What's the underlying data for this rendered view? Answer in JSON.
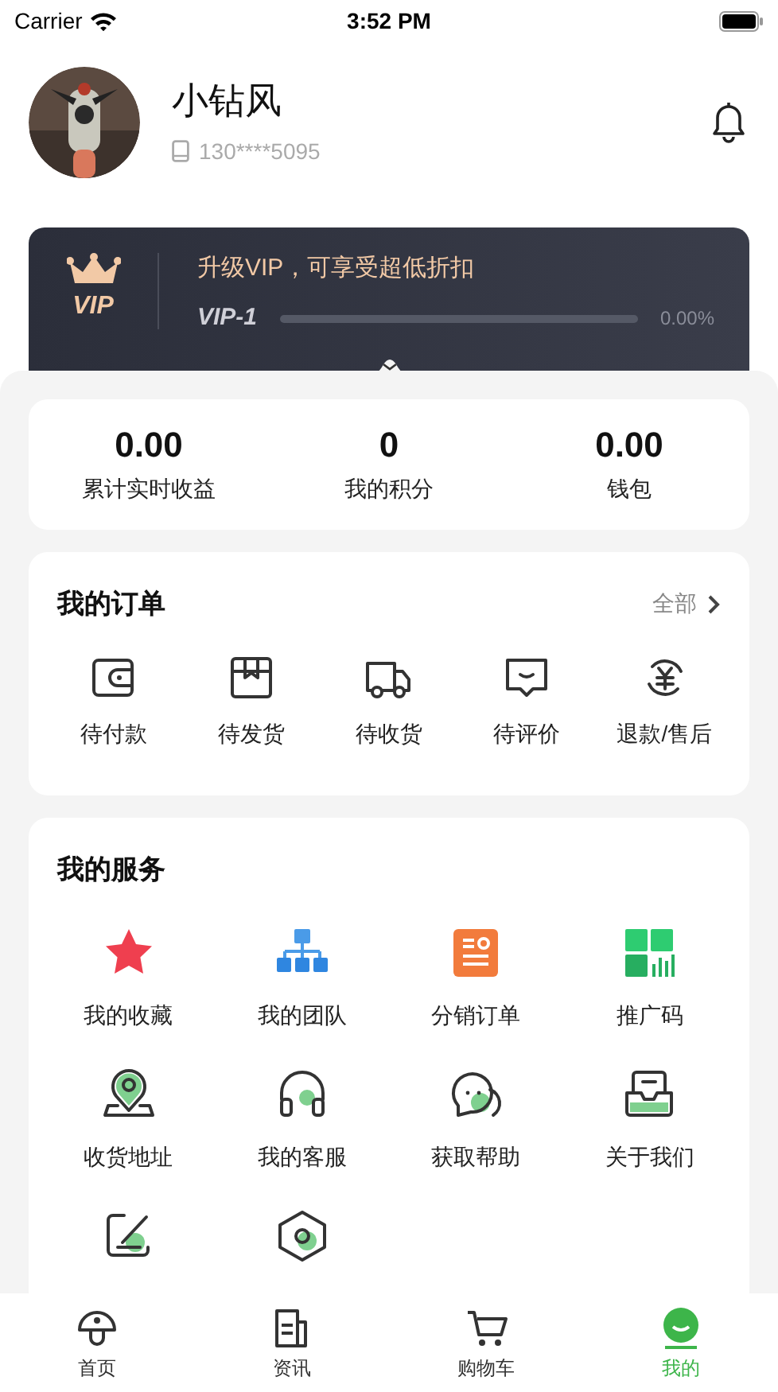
{
  "status_bar": {
    "carrier": "Carrier",
    "time": "3:52 PM"
  },
  "profile": {
    "name": "小钻风",
    "phone": "130****5095"
  },
  "vip": {
    "badge": "VIP",
    "promo": "升级VIP，可享受超低折扣",
    "level_label": "VIP-1",
    "level": 0,
    "percent": "0.00%"
  },
  "stats": [
    {
      "value": "0.00",
      "label": "累计实时收益"
    },
    {
      "value": "0",
      "label": "我的积分"
    },
    {
      "value": "0.00",
      "label": "钱包"
    }
  ],
  "orders": {
    "title": "我的订单",
    "all_link": "全部",
    "items": [
      {
        "kind": "wallet",
        "label": "待付款"
      },
      {
        "kind": "box",
        "label": "待发货"
      },
      {
        "kind": "truck",
        "label": "待收货"
      },
      {
        "kind": "comment",
        "label": "待评价"
      },
      {
        "kind": "refund",
        "label": "退款/售后"
      }
    ]
  },
  "services": {
    "title": "我的服务",
    "items": [
      {
        "kind": "star",
        "label": "我的收藏"
      },
      {
        "kind": "team",
        "label": "我的团队"
      },
      {
        "kind": "list",
        "label": "分销订单"
      },
      {
        "kind": "qr",
        "label": "推广码"
      },
      {
        "kind": "location",
        "label": "收货地址"
      },
      {
        "kind": "headset",
        "label": "我的客服"
      },
      {
        "kind": "chat",
        "label": "获取帮助"
      },
      {
        "kind": "inbox",
        "label": "关于我们"
      },
      {
        "kind": "edit"
      },
      {
        "kind": "settings"
      }
    ]
  },
  "tab_bar": [
    {
      "kind": "home",
      "label": "首页",
      "selected": false
    },
    {
      "kind": "news",
      "label": "资讯",
      "selected": false
    },
    {
      "kind": "cart",
      "label": "购物车",
      "selected": false
    },
    {
      "kind": "me",
      "label": "我的",
      "selected": true
    }
  ]
}
